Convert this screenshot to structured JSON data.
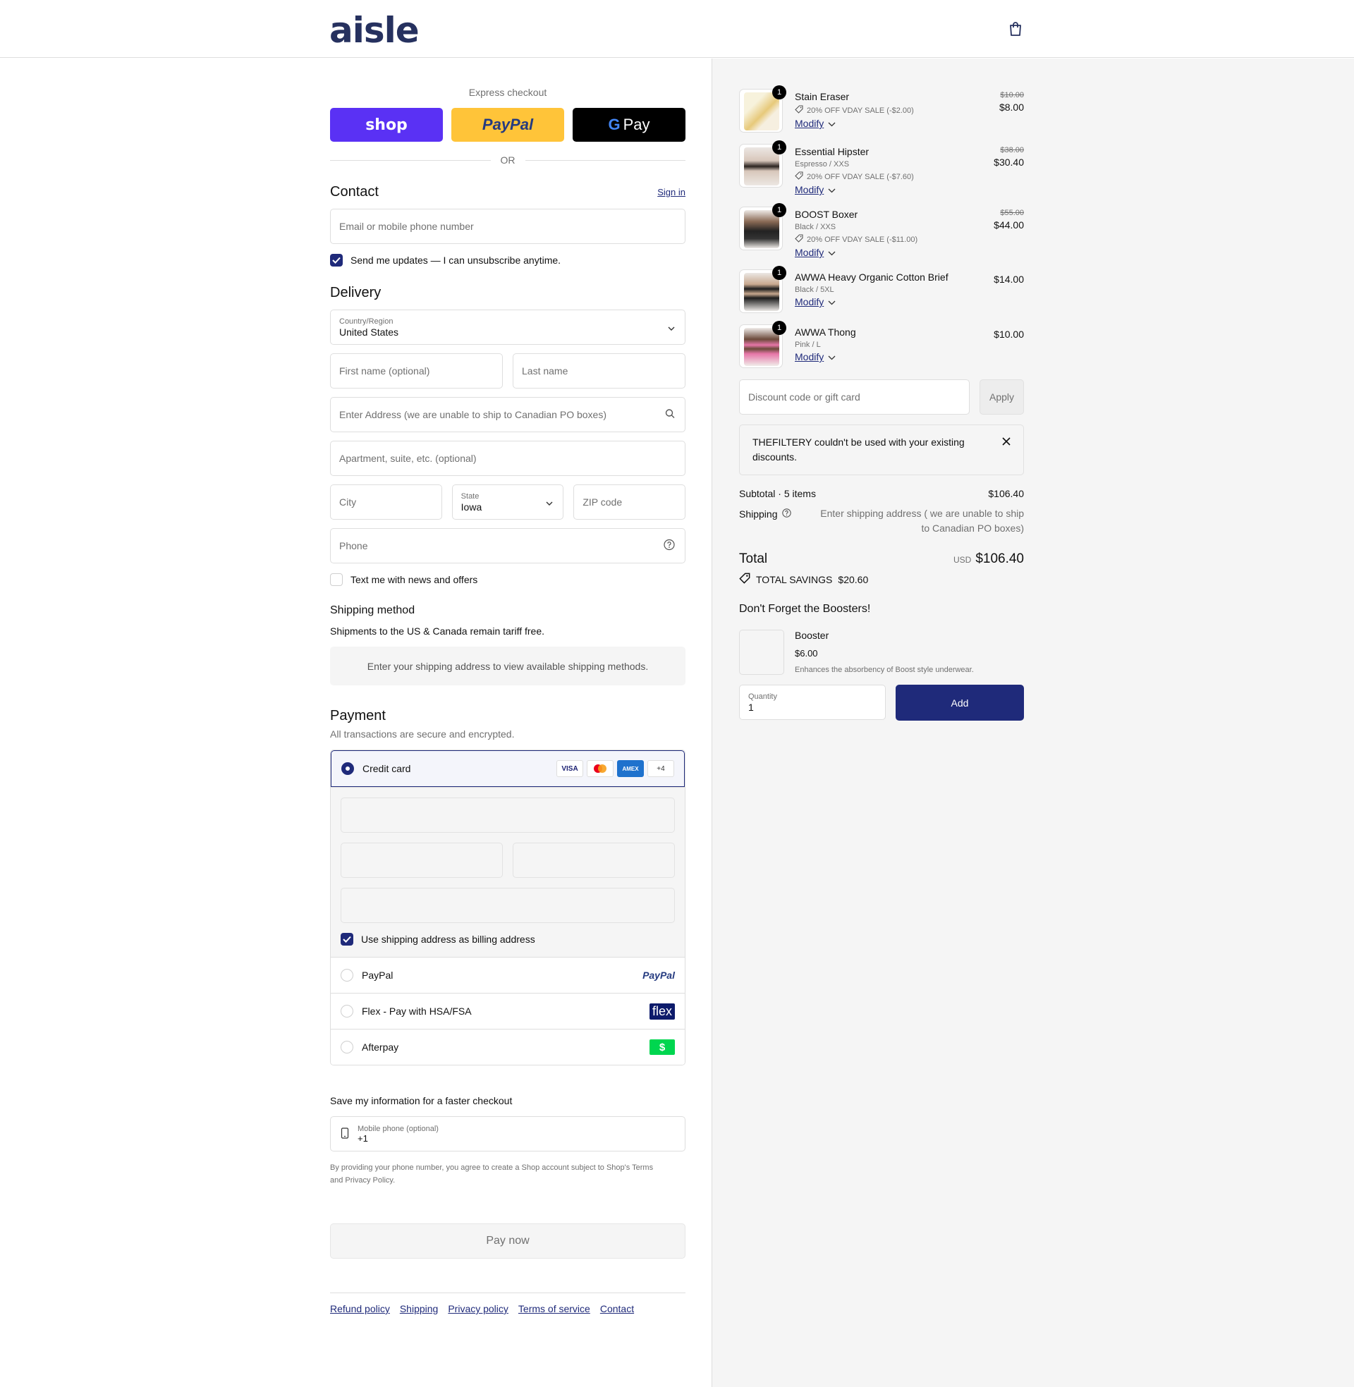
{
  "brand": "aisle",
  "express": {
    "label": "Express checkout",
    "shop": "shop",
    "paypal": "PayPal",
    "gpay": "Pay",
    "or": "OR"
  },
  "contact": {
    "title": "Contact",
    "sign_in": "Sign in",
    "email_placeholder": "Email or mobile phone number",
    "updates": "Send me updates — I can unsubscribe anytime."
  },
  "delivery": {
    "title": "Delivery",
    "country_label": "Country/Region",
    "country_value": "United States",
    "first_name": "First name (optional)",
    "last_name": "Last name",
    "address": "Enter Address (we are unable to ship to Canadian PO boxes)",
    "apartment": "Apartment, suite, etc. (optional)",
    "city": "City",
    "state_label": "State",
    "state_value": "Iowa",
    "zip": "ZIP code",
    "phone": "Phone",
    "text_me": "Text me with news and offers"
  },
  "shipping_method": {
    "title": "Shipping method",
    "note": "Shipments to the US & Canada remain tariff free.",
    "placeholder": "Enter your shipping address to view available shipping methods."
  },
  "payment": {
    "title": "Payment",
    "subtitle": "All transactions are secure and encrypted.",
    "credit_card": "Credit card",
    "card_logos": [
      "VISA",
      "MC",
      "AMEX",
      "+4"
    ],
    "billing_same": "Use shipping address as billing address",
    "paypal": "PayPal",
    "paypal_logo": "PayPal",
    "flex": "Flex - Pay with HSA/FSA",
    "flex_logo": "flex",
    "afterpay": "Afterpay",
    "afterpay_logo": "$"
  },
  "save_info": {
    "title": "Save my information for a faster checkout",
    "phone_label": "Mobile phone (optional)",
    "phone_value": "+1",
    "fine_pre": "By providing your phone number, you agree to create a Shop account subject to Shop's",
    "terms": "Terms",
    "and": "and",
    "privacy": "Privacy Policy",
    "period": "."
  },
  "pay_now": "Pay now",
  "footer": [
    "Refund policy",
    "Shipping",
    "Privacy policy",
    "Terms of service",
    "Contact"
  ],
  "cart": {
    "items": [
      {
        "qty": "1",
        "name": "Stain Eraser",
        "variant": "",
        "discount": "20% OFF VDAY SALE (-$2.00)",
        "modify": "Modify",
        "old": "$10.00",
        "price": "$8.00"
      },
      {
        "qty": "1",
        "name": "Essential Hipster",
        "variant": "Espresso / XXS",
        "discount": "20% OFF VDAY SALE (-$7.60)",
        "modify": "Modify",
        "old": "$38.00",
        "price": "$30.40"
      },
      {
        "qty": "1",
        "name": "BOOST Boxer",
        "variant": "Black / XXS",
        "discount": "20% OFF VDAY SALE (-$11.00)",
        "modify": "Modify",
        "old": "$55.00",
        "price": "$44.00"
      },
      {
        "qty": "1",
        "name": "AWWA Heavy Organic Cotton Brief",
        "variant": "Black / 5XL",
        "discount": "",
        "modify": "Modify",
        "old": "",
        "price": "$14.00"
      },
      {
        "qty": "1",
        "name": "AWWA Thong",
        "variant": "Pink / L",
        "discount": "",
        "modify": "Modify",
        "old": "",
        "price": "$10.00"
      }
    ],
    "discount_placeholder": "Discount code or gift card",
    "apply": "Apply",
    "alert": "THEFILTERY couldn't be used with your existing discounts.",
    "subtotal_label": "Subtotal · 5 items",
    "subtotal_value": "$106.40",
    "shipping_label": "Shipping",
    "shipping_note": "Enter shipping address ( we are unable to ship to Canadian PO boxes)",
    "total_label": "Total",
    "currency": "USD",
    "total_value": "$106.40",
    "savings_label": "TOTAL SAVINGS",
    "savings_value": "$20.60"
  },
  "boosters": {
    "title": "Don't Forget the Boosters!",
    "name": "Booster",
    "price": "$6.00",
    "desc": "Enhances the absorbency of Boost style underwear.",
    "qty_label": "Quantity",
    "qty_value": "1",
    "add": "Add"
  },
  "colors": {
    "accent": "#1f2a7a",
    "shop": "#5a31f4",
    "paypal": "#ffc439",
    "afterpay": "#00d64f"
  }
}
